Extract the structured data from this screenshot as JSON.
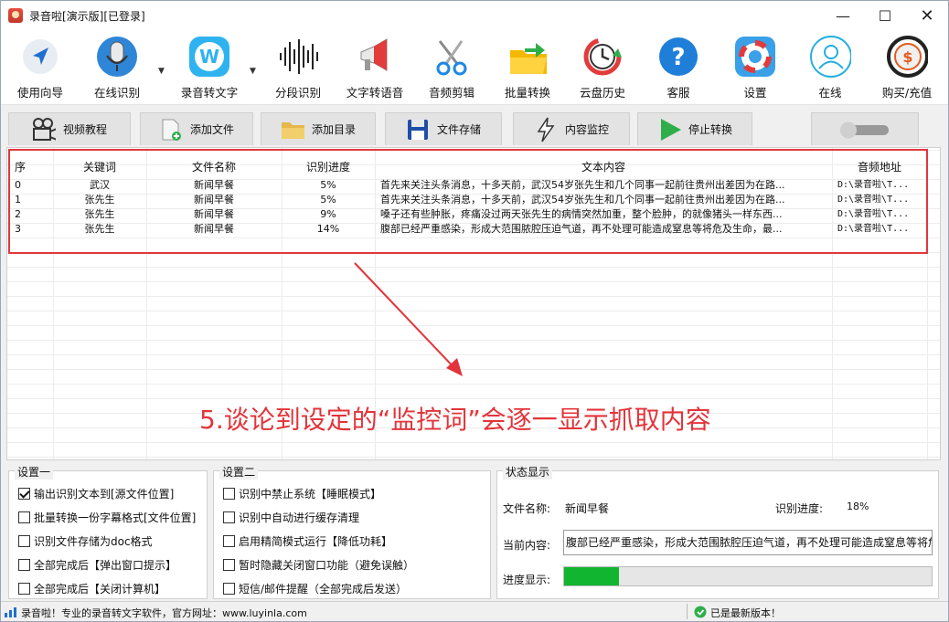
{
  "window": {
    "title": "录音啦[演示版][已登录]"
  },
  "toolbar": [
    {
      "label": "使用向导",
      "icon": "cursor-arrow-icon"
    },
    {
      "label": "在线识别",
      "icon": "microphone-icon"
    },
    {
      "label": "录音转文字",
      "icon": "w-badge-icon"
    },
    {
      "label": "分段识别",
      "icon": "soundwave-icon"
    },
    {
      "label": "文字转语音",
      "icon": "megaphone-icon"
    },
    {
      "label": "音频剪辑",
      "icon": "scissors-icon"
    },
    {
      "label": "批量转换",
      "icon": "folder-arrow-icon"
    },
    {
      "label": "云盘历史",
      "icon": "history-clock-icon"
    },
    {
      "label": "客服",
      "icon": "help-question-icon"
    },
    {
      "label": "设置",
      "icon": "lifebuoy-icon"
    },
    {
      "label": "在线",
      "icon": "user-circle-icon"
    },
    {
      "label": "购买/充值",
      "icon": "dollar-coin-icon"
    }
  ],
  "toolbar2": [
    {
      "label": "视频教程",
      "icon": "video-camera-icon"
    },
    {
      "label": "添加文件",
      "icon": "add-file-icon"
    },
    {
      "label": "添加目录",
      "icon": "folder-icon"
    },
    {
      "label": "文件存储",
      "icon": "floppy-disk-icon"
    },
    {
      "label": "内容监控",
      "icon": "lightning-icon"
    },
    {
      "label": "停止转换",
      "icon": "play-triangle-icon"
    }
  ],
  "table": {
    "headers": [
      "序",
      "关键词",
      "文件名称",
      "识别进度",
      "文本内容",
      "音频地址"
    ],
    "rows": [
      [
        "0",
        "武汉",
        "新闻早餐",
        "5%",
        "首先来关注头条消息，十多天前，武汉54岁张先生和几个同事一起前往贵州出差因为在路...",
        "D:\\录音啦\\T..."
      ],
      [
        "1",
        "张先生",
        "新闻早餐",
        "5%",
        "首先来关注头条消息，十多天前，武汉54岁张先生和几个同事一起前往贵州出差因为在路...",
        "D:\\录音啦\\T..."
      ],
      [
        "2",
        "张先生",
        "新闻早餐",
        "9%",
        "嗓子还有些肿胀，疼痛没过两天张先生的病情突然加重，整个脸肿，的就像猪头一样东西...",
        "D:\\录音啦\\T..."
      ],
      [
        "3",
        "张先生",
        "新闻早餐",
        "14%",
        "腹部已经严重感染，形成大范围脓腔压迫气道，再不处理可能造成窒息等将危及生命，最...",
        "D:\\录音啦\\T..."
      ]
    ]
  },
  "annotation": "5.谈论到设定的“监控词”会逐一显示抓取内容",
  "settings1": {
    "title": "设置一",
    "items": [
      {
        "label": "输出识别文本到[源文件位置]",
        "checked": true
      },
      {
        "label": "批量转换一份字幕格式[文件位置]",
        "checked": false
      },
      {
        "label": "识别文件存储为doc格式",
        "checked": false
      },
      {
        "label": "全部完成后【弹出窗口提示】",
        "checked": false
      },
      {
        "label": "全部完成后【关闭计算机】",
        "checked": false
      }
    ]
  },
  "settings2": {
    "title": "设置二",
    "items": [
      {
        "label": "识别中禁止系统【睡眠模式】",
        "checked": false
      },
      {
        "label": "识别中自动进行缓存清理",
        "checked": false
      },
      {
        "label": "启用精简模式运行【降低功耗】",
        "checked": false
      },
      {
        "label": "暂时隐藏关闭窗口功能（避免误触）",
        "checked": false
      },
      {
        "label": "短信/邮件提醒（全部完成后发送）",
        "checked": false
      }
    ]
  },
  "statusPanel": {
    "title": "状态显示",
    "file_label": "文件名称:",
    "file_value": "新闻早餐",
    "progress_label": "识别进度:",
    "progress_value": "18%",
    "content_label": "当前内容:",
    "content_value": "腹部已经严重感染，形成大范围脓腔压迫气道，再不处理可能造成窒息等将危",
    "bar_label": "进度显示:",
    "bar_fraction": 0.15
  },
  "statusbar": {
    "left": "录音啦！专业的录音转文字软件，官方网址：www.luyinla.com",
    "right": "已是最新版本！"
  }
}
